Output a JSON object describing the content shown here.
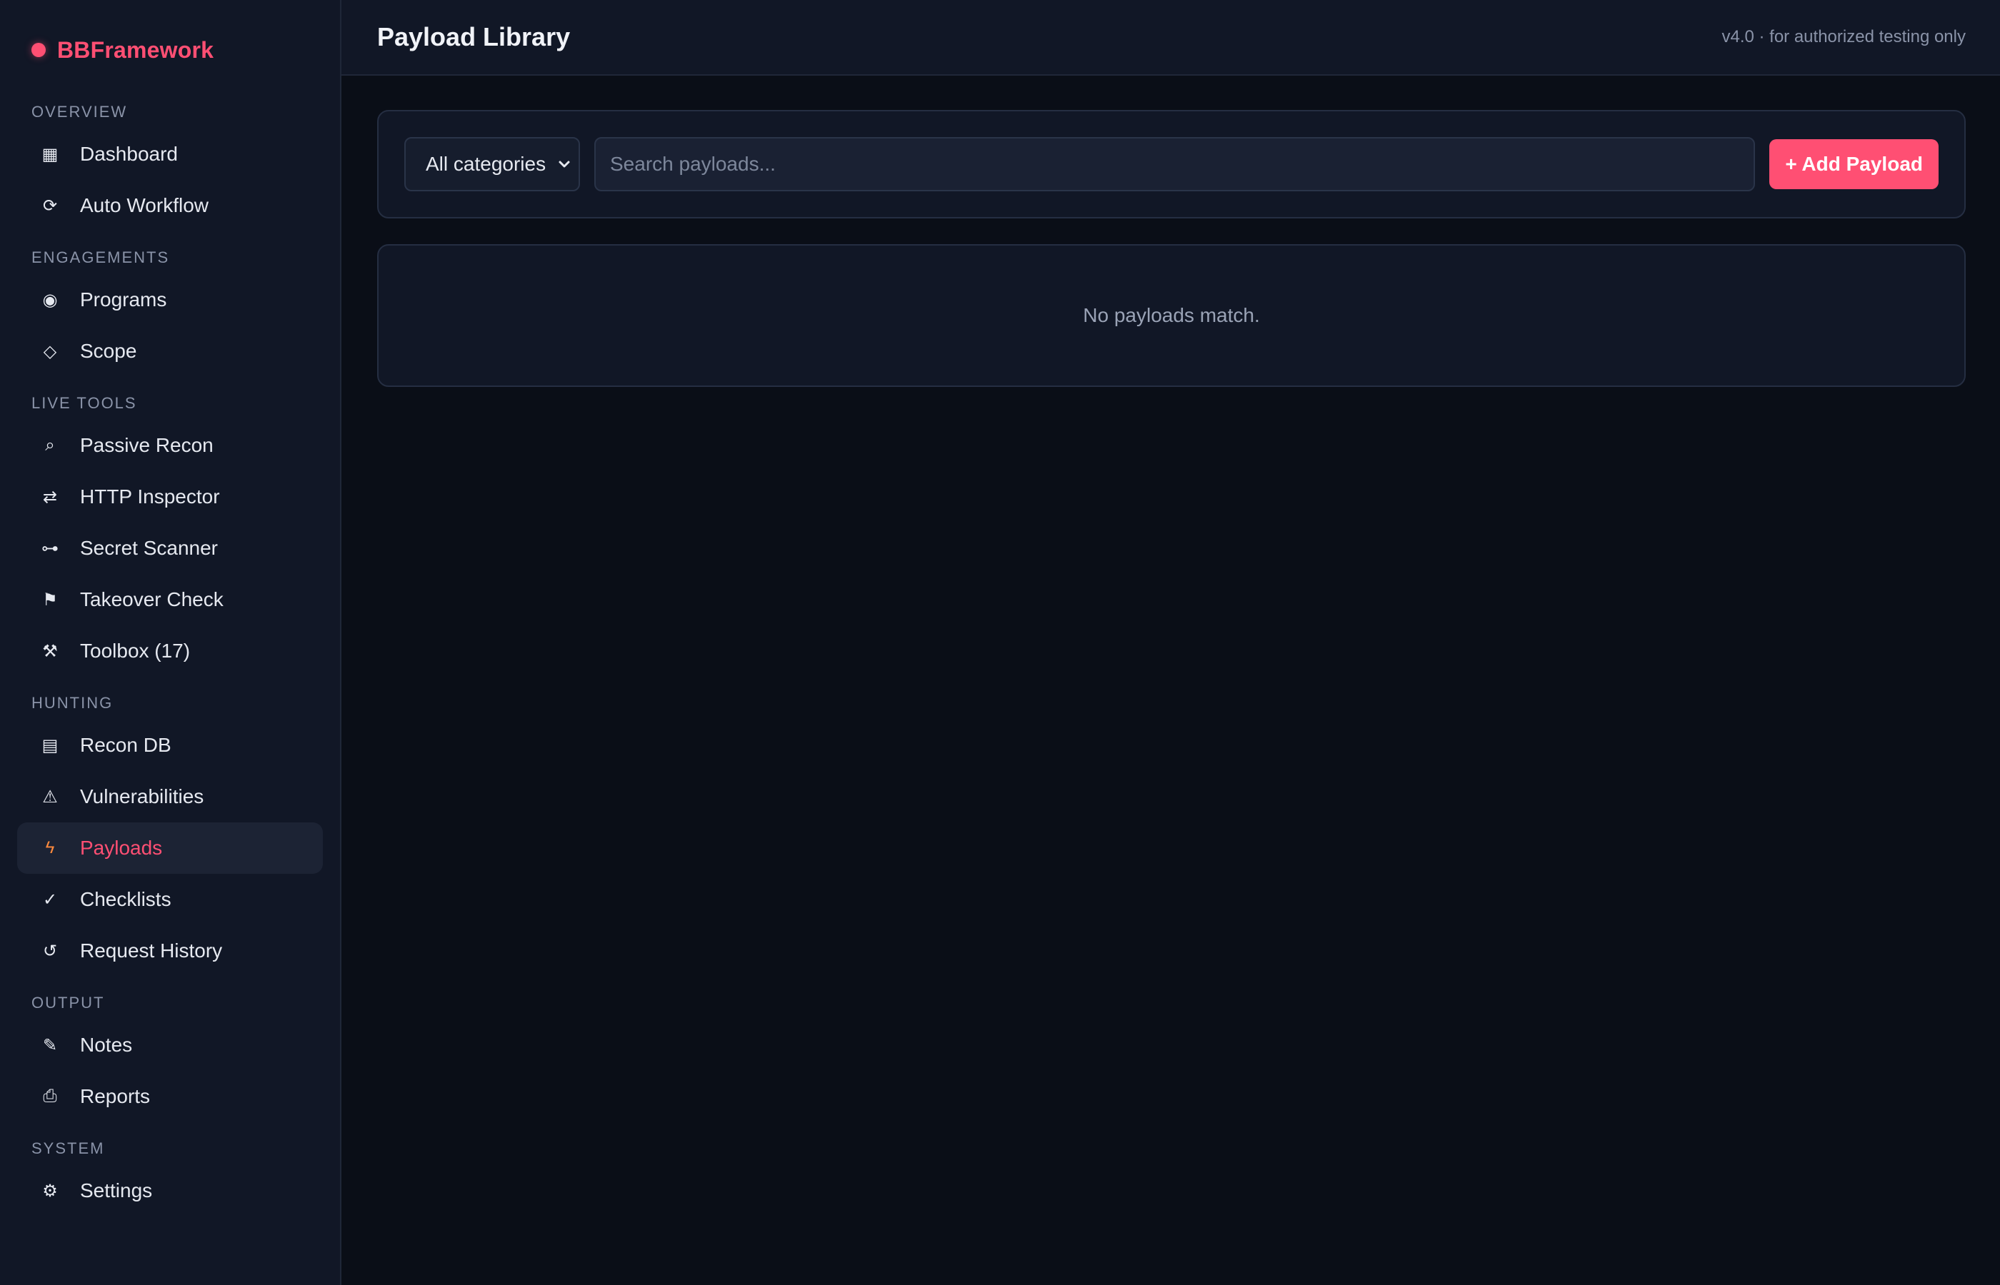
{
  "brand": {
    "name": "BBFramework",
    "accent": "#ff4f73"
  },
  "sidebar": {
    "sections": [
      {
        "label": "OVERVIEW",
        "items": [
          {
            "label": "Dashboard",
            "icon": "grid-icon"
          },
          {
            "label": "Auto Workflow",
            "icon": "refresh-icon"
          }
        ]
      },
      {
        "label": "ENGAGEMENTS",
        "items": [
          {
            "label": "Programs",
            "icon": "target-icon"
          },
          {
            "label": "Scope",
            "icon": "diamond-icon"
          }
        ]
      },
      {
        "label": "LIVE TOOLS",
        "items": [
          {
            "label": "Passive Recon",
            "icon": "search-icon"
          },
          {
            "label": "HTTP Inspector",
            "icon": "swap-arrows-icon"
          },
          {
            "label": "Secret Scanner",
            "icon": "key-icon"
          },
          {
            "label": "Takeover Check",
            "icon": "flag-icon"
          },
          {
            "label": "Toolbox (17)",
            "icon": "tools-icon"
          }
        ]
      },
      {
        "label": "HUNTING",
        "items": [
          {
            "label": "Recon DB",
            "icon": "database-icon"
          },
          {
            "label": "Vulnerabilities",
            "icon": "warning-icon"
          },
          {
            "label": "Payloads",
            "icon": "lightning-icon",
            "active": true
          },
          {
            "label": "Checklists",
            "icon": "check-icon"
          },
          {
            "label": "Request History",
            "icon": "history-icon"
          }
        ]
      },
      {
        "label": "OUTPUT",
        "items": [
          {
            "label": "Notes",
            "icon": "pencil-icon"
          },
          {
            "label": "Reports",
            "icon": "report-icon"
          }
        ]
      },
      {
        "label": "SYSTEM",
        "items": [
          {
            "label": "Settings",
            "icon": "gear-icon"
          }
        ]
      }
    ]
  },
  "header": {
    "title": "Payload Library",
    "version": "v4.0 · for authorized testing only"
  },
  "filters": {
    "category": "All categories",
    "search_placeholder": "Search payloads...",
    "add_label": "+ Add Payload"
  },
  "results": {
    "empty_text": "No payloads match."
  }
}
